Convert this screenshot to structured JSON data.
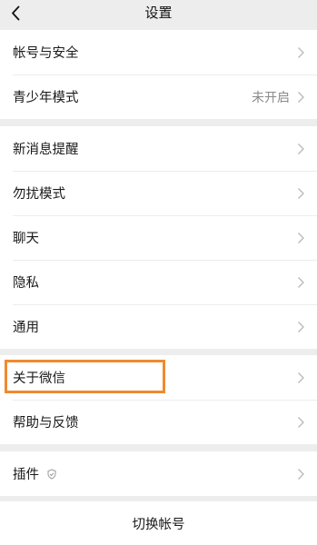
{
  "nav": {
    "title": "设置",
    "back_icon": "chevron-left-icon"
  },
  "groups": [
    {
      "items": [
        {
          "label": "帐号与安全",
          "value": ""
        },
        {
          "label": "青少年模式",
          "value": "未开启"
        }
      ]
    },
    {
      "items": [
        {
          "label": "新消息提醒",
          "value": ""
        },
        {
          "label": "勿扰模式",
          "value": ""
        },
        {
          "label": "聊天",
          "value": ""
        },
        {
          "label": "隐私",
          "value": ""
        },
        {
          "label": "通用",
          "value": ""
        }
      ]
    },
    {
      "items": [
        {
          "label": "关于微信",
          "value": ""
        },
        {
          "label": "帮助与反馈",
          "value": ""
        }
      ]
    },
    {
      "items": [
        {
          "label": "插件",
          "value": "",
          "badge_icon": "shield-icon"
        }
      ]
    }
  ],
  "switch_account": {
    "label": "切换帐号"
  },
  "colors": {
    "background": "#ededed",
    "cell": "#ffffff",
    "highlight": "#f08a2e",
    "secondary_text": "#8a8a8a"
  }
}
